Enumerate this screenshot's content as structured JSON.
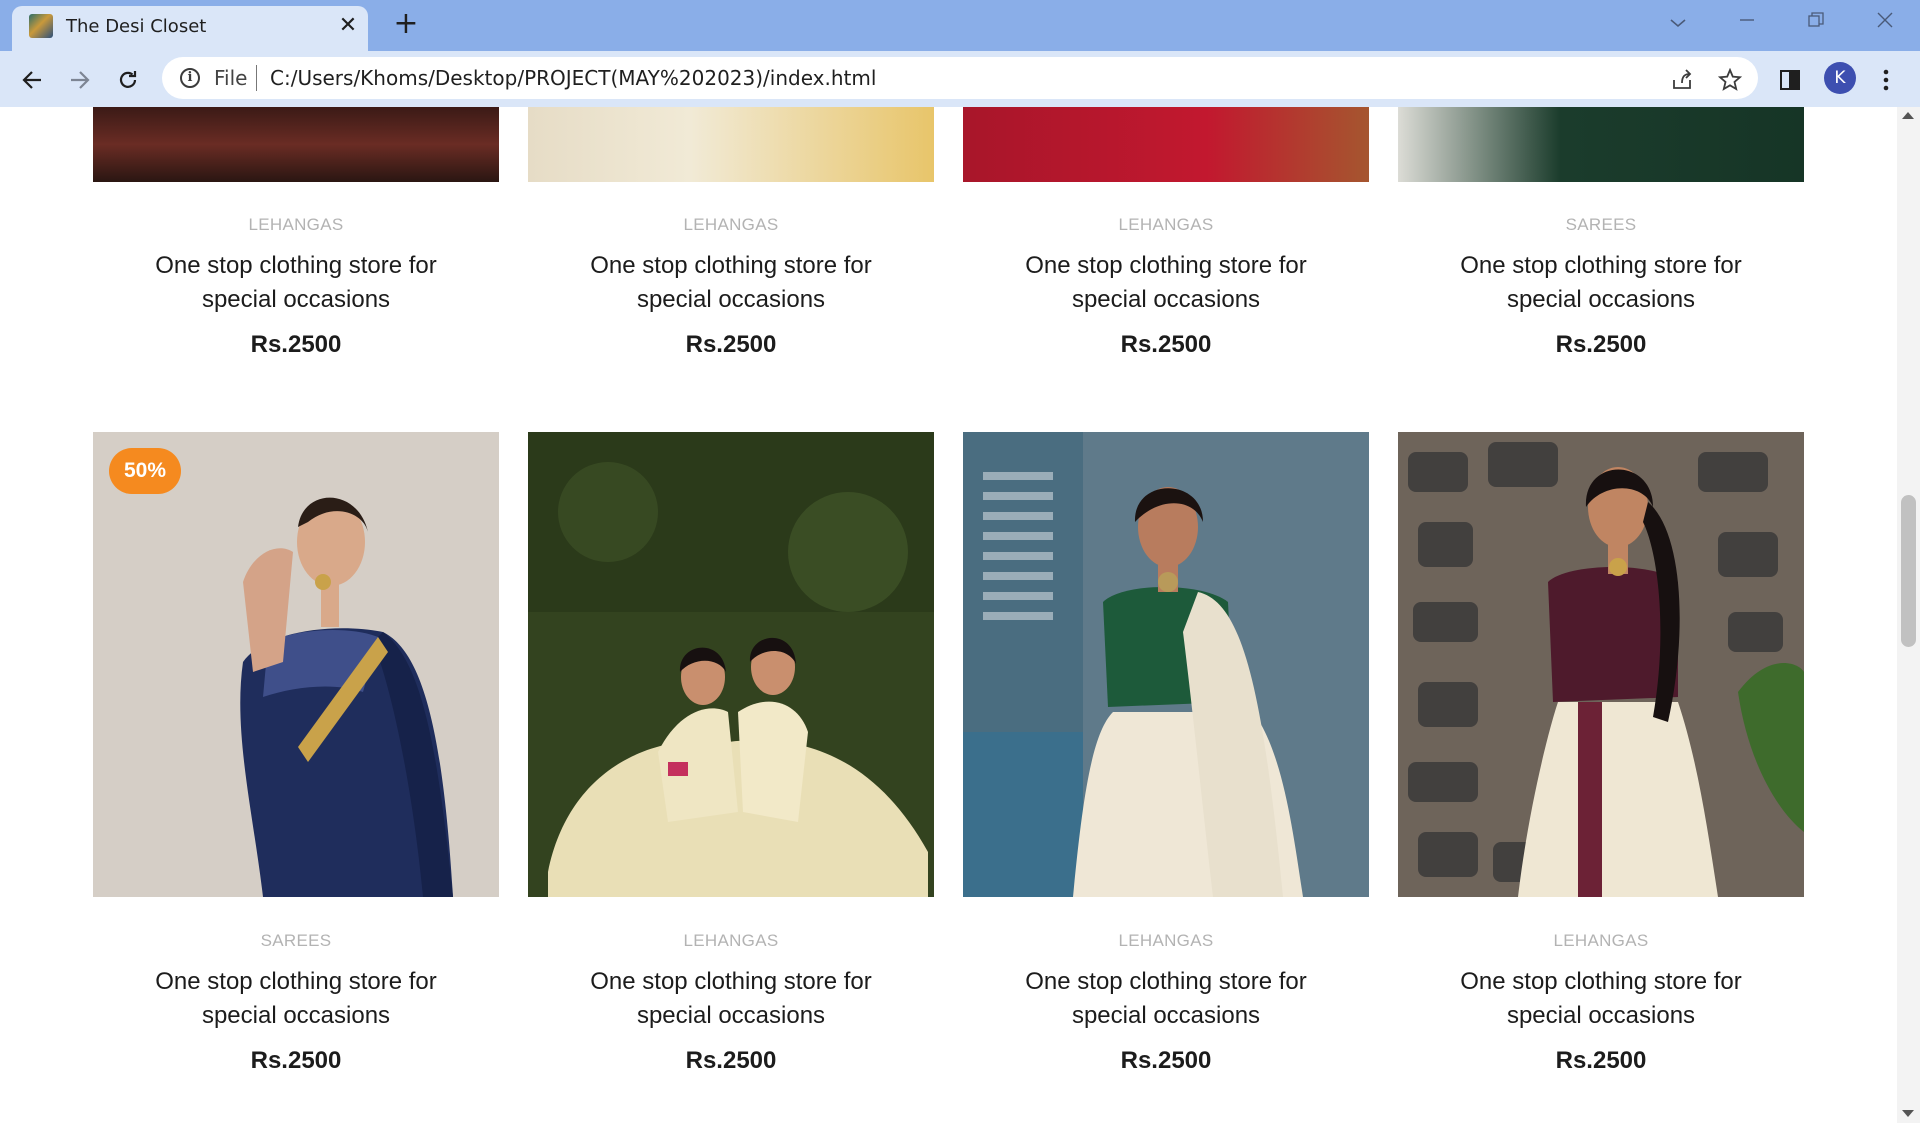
{
  "browser": {
    "tab_title": "The Desi Closet",
    "close_glyph": "✕",
    "new_tab_glyph": "+",
    "file_label": "File",
    "url": "C:/Users/Khoms/Desktop/PROJECT(MAY%202023)/index.html",
    "profile_initial": "K",
    "icons": [
      "back-arrow-icon",
      "forward-arrow-icon",
      "reload-icon",
      "info-icon",
      "share-icon",
      "bookmark-star-icon",
      "side-panel-icon",
      "kebab-menu-icon"
    ],
    "window_controls": [
      "chevron-down-icon",
      "minimize-icon",
      "restore-icon",
      "close-icon"
    ]
  },
  "products_row1": [
    {
      "category": "LEHANGAS",
      "title": "One stop clothing store for special occasions",
      "price": "Rs.2500"
    },
    {
      "category": "LEHANGAS",
      "title": "One stop clothing store for special occasions",
      "price": "Rs.2500"
    },
    {
      "category": "LEHANGAS",
      "title": "One stop clothing store for special occasions",
      "price": "Rs.2500"
    },
    {
      "category": "SAREES",
      "title": "One stop clothing store for special occasions",
      "price": "Rs.2500"
    }
  ],
  "products_row2": [
    {
      "category": "SAREES",
      "title": "One stop clothing store for special occasions",
      "price": "Rs.2500",
      "badge": "50%"
    },
    {
      "category": "LEHANGAS",
      "title": "One stop clothing store for special occasions",
      "price": "Rs.2500"
    },
    {
      "category": "LEHANGAS",
      "title": "One stop clothing store for special occasions",
      "price": "Rs.2500"
    },
    {
      "category": "LEHANGAS",
      "title": "One stop clothing store for special occasions",
      "price": "Rs.2500"
    }
  ],
  "colors": {
    "badge": "#f58a1f",
    "category": "#b3b3b3",
    "text": "#1c1c1c",
    "tabstrip": "#8aaee8"
  }
}
